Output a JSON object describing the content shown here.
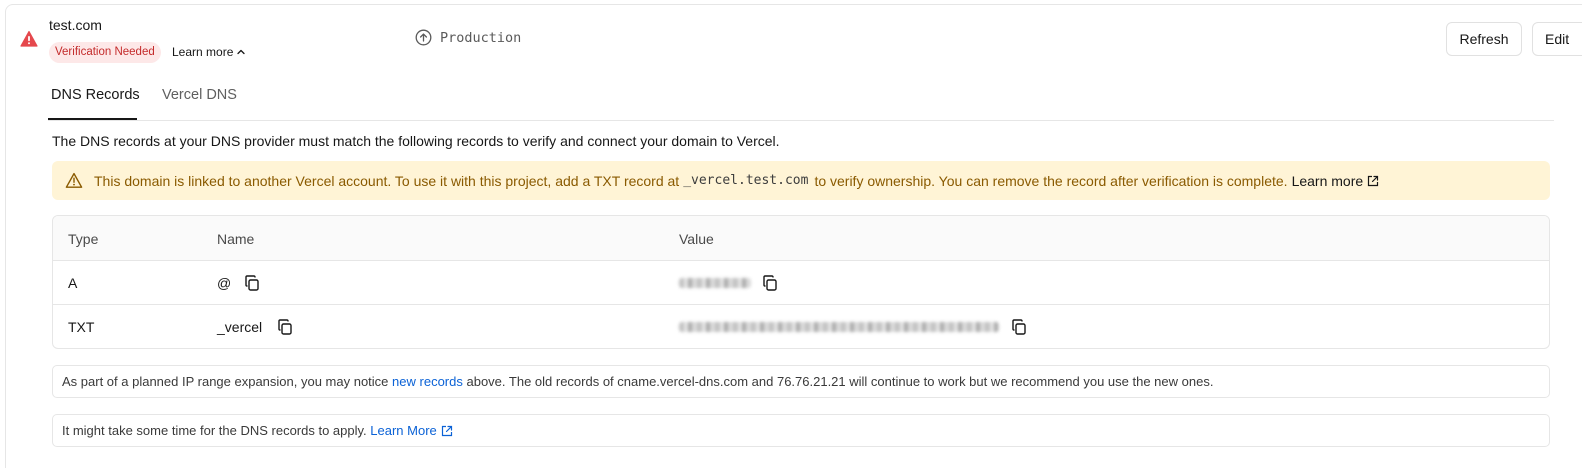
{
  "domain": {
    "name": "test.com",
    "status_badge": "Verification Needed",
    "learn_more_toggle": "Learn more",
    "environment": "Production"
  },
  "actions": {
    "refresh": "Refresh",
    "edit": "Edit"
  },
  "tabs": [
    {
      "label": "DNS Records",
      "active": true
    },
    {
      "label": "Vercel DNS",
      "active": false
    }
  ],
  "intro": "The DNS records at your DNS provider must match the following records to verify and connect your domain to Vercel.",
  "alert": {
    "text_before": "This domain is linked to another Vercel account. To use it with this project, add a TXT record at",
    "code": "_vercel.test.com",
    "text_after": "to verify ownership. You can remove the record after verification is complete.",
    "link": "Learn more"
  },
  "table": {
    "headers": {
      "type": "Type",
      "name": "Name",
      "value": "Value"
    },
    "rows": [
      {
        "type": "A",
        "name": "@",
        "value": ""
      },
      {
        "type": "TXT",
        "name": "_vercel",
        "value": ""
      }
    ]
  },
  "notes": {
    "ip_expansion": {
      "before": "As part of a planned IP range expansion, you may notice",
      "link": "new records",
      "after": "above. The old records of cname.vercel-dns.com and 76.76.21.21 will continue to work but we recommend you use the new ones."
    },
    "propagation": {
      "text": "It might take some time for the DNS records to apply.",
      "link": "Learn More"
    }
  },
  "colors": {
    "error": "#e5484d",
    "badge_bg": "#fde8e8",
    "warning_bg": "#fff4d6",
    "warning_text": "#8a5a00",
    "link": "#0b62d6"
  }
}
